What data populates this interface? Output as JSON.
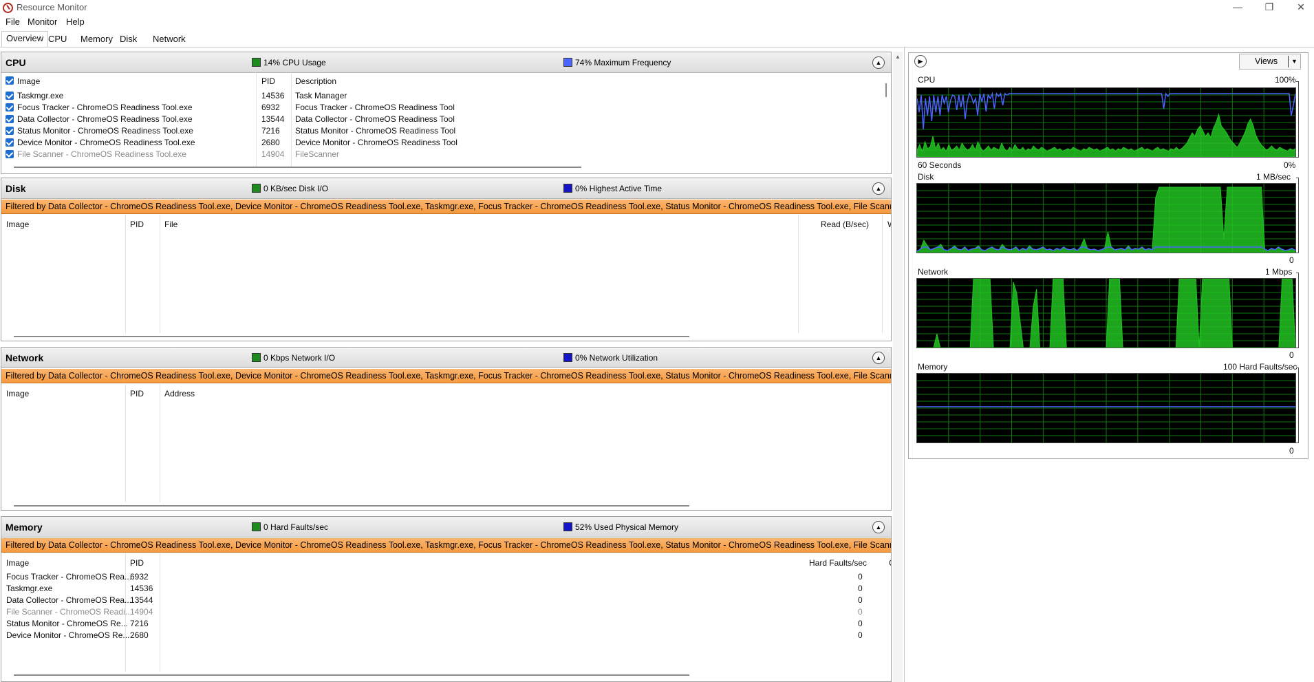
{
  "window": {
    "title": "Resource Monitor",
    "controls": {
      "minimize": "—",
      "restore": "❐",
      "close": "✕"
    }
  },
  "menu": [
    "File",
    "Monitor",
    "Help"
  ],
  "tabs": [
    "Overview",
    "CPU",
    "Memory",
    "Disk",
    "Network"
  ],
  "active_tab": "Overview",
  "colors": {
    "filter_bar": "#f59a3f",
    "legend_green": "#1f8a1f",
    "legend_blue": "#1515c8",
    "graph_bg": "#000000",
    "graph_grid": "#117711",
    "graph_fill": "#22c322",
    "graph_blue": "#4a64ff",
    "graph_orange": "#f08c1a"
  },
  "icons": {
    "collapse": "chevron-up-icon",
    "nav": "chevron-right-icon",
    "views_dropdown": "triangle-down-icon",
    "app": "resource-monitor-icon"
  },
  "cpu": {
    "title": "CPU",
    "usage": "14% CPU Usage",
    "frequency": "74% Maximum Frequency",
    "columns": [
      "Image",
      "PID",
      "Description"
    ],
    "rows": [
      {
        "image": "Taskmgr.exe",
        "pid": "14536",
        "description": "Task Manager"
      },
      {
        "image": "Focus Tracker - ChromeOS Readiness Tool.exe",
        "pid": "6932",
        "description": "Focus Tracker - ChromeOS Readiness Tool"
      },
      {
        "image": "Data Collector - ChromeOS Readiness Tool.exe",
        "pid": "13544",
        "description": "Data Collector - ChromeOS Readiness Tool"
      },
      {
        "image": "Status Monitor - ChromeOS Readiness Tool.exe",
        "pid": "7216",
        "description": "Status Monitor - ChromeOS Readiness Tool"
      },
      {
        "image": "Device Monitor - ChromeOS Readiness Tool.exe",
        "pid": "2680",
        "description": "Device Monitor - ChromeOS Readiness Tool"
      },
      {
        "image": "File Scanner - ChromeOS Readiness Tool.exe",
        "pid": "14904",
        "description": "FileScanner"
      }
    ]
  },
  "filter_text": "Filtered by Data Collector - ChromeOS Readiness Tool.exe, Device Monitor - ChromeOS Readiness Tool.exe, Taskmgr.exe, Focus Tracker - ChromeOS Readiness Tool.exe, Status Monitor - ChromeOS Readiness Tool.exe, File Scanner - ChromeOS",
  "disk": {
    "title": "Disk",
    "io": "0 KB/sec Disk I/O",
    "active": "0% Highest Active Time",
    "columns": [
      "Image",
      "PID",
      "File",
      "Read (B/sec)",
      "W"
    ]
  },
  "network": {
    "title": "Network",
    "io": "0 Kbps Network I/O",
    "utilization": "0% Network Utilization",
    "columns": [
      "Image",
      "PID",
      "Address"
    ]
  },
  "memory": {
    "title": "Memory",
    "faults": "0 Hard Faults/sec",
    "used": "52% Used Physical Memory",
    "columns": [
      "Image",
      "PID",
      "Hard Faults/sec",
      "C"
    ],
    "rows": [
      {
        "image": "Focus Tracker - ChromeOS Rea...",
        "pid": "6932",
        "faults": "0"
      },
      {
        "image": "Taskmgr.exe",
        "pid": "14536",
        "faults": "0"
      },
      {
        "image": "Data Collector - ChromeOS Rea...",
        "pid": "13544",
        "faults": "0"
      },
      {
        "image": "File Scanner - ChromeOS Readi...",
        "pid": "14904",
        "faults": "0"
      },
      {
        "image": "Status Monitor - ChromeOS Re...",
        "pid": "7216",
        "faults": "0"
      },
      {
        "image": "Device Monitor - ChromeOS Re...",
        "pid": "2680",
        "faults": "0"
      }
    ]
  },
  "graphs": {
    "views_label": "Views",
    "cpu": {
      "label": "CPU",
      "max": "100%",
      "time": "60 Seconds",
      "min": "0%"
    },
    "disk": {
      "label": "Disk",
      "max": "1 MB/sec",
      "min": "0"
    },
    "network": {
      "label": "Network",
      "max": "1 Mbps",
      "min": "0"
    },
    "memory": {
      "label": "Memory",
      "max": "100 Hard Faults/sec",
      "min": "0"
    }
  },
  "graph_series": {
    "cpu_blue": [
      85,
      65,
      90,
      40,
      85,
      60,
      88,
      52,
      90,
      65,
      88,
      60,
      90,
      78,
      88,
      65,
      82,
      90,
      88,
      68,
      90,
      72,
      90,
      55,
      80,
      92,
      88,
      78,
      85,
      60,
      92,
      80,
      92,
      66,
      90,
      85,
      92,
      70,
      92,
      88,
      92,
      75,
      92,
      90,
      92,
      92,
      92,
      92,
      92,
      92,
      92,
      92,
      92,
      92,
      92,
      92,
      92,
      92,
      92,
      92,
      92,
      92,
      92,
      92,
      92,
      92,
      92,
      92,
      92,
      92,
      92,
      92,
      92,
      92,
      92,
      92,
      92,
      92,
      92,
      92,
      92,
      92,
      92,
      92,
      92,
      92,
      92,
      92,
      92,
      92,
      92,
      92,
      92,
      92,
      92,
      92,
      92,
      92,
      92,
      92,
      92,
      92,
      92,
      92,
      92,
      92,
      92,
      92,
      92,
      92,
      92,
      92,
      92,
      92,
      92,
      92,
      92,
      92,
      70,
      92,
      88,
      92,
      92,
      92,
      92,
      92,
      92,
      92,
      92,
      92,
      92,
      92,
      92,
      92,
      92,
      92,
      92,
      92,
      92,
      92,
      92,
      92,
      92,
      92,
      92,
      92,
      92,
      92,
      92,
      92,
      92,
      92,
      92,
      92,
      92,
      92,
      92,
      92,
      92,
      92,
      92,
      92,
      92,
      92,
      92,
      92,
      92,
      92,
      92,
      92,
      92,
      92,
      92,
      92,
      92,
      92,
      92,
      92,
      92,
      60,
      75,
      92
    ],
    "cpu_green": [
      10,
      18,
      8,
      22,
      12,
      15,
      30,
      12,
      20,
      10,
      14,
      8,
      18,
      10,
      12,
      16,
      10,
      20,
      14,
      10,
      12,
      18,
      10,
      22,
      14,
      8,
      12,
      16,
      10,
      14,
      12,
      10,
      20,
      12,
      8,
      14,
      10,
      18,
      12,
      10,
      14,
      8,
      12,
      10,
      16,
      12,
      10,
      14,
      12,
      8,
      10,
      12,
      14,
      10,
      12,
      8,
      10,
      12,
      10,
      14,
      12,
      10,
      8,
      12,
      10,
      14,
      12,
      10,
      12,
      8,
      10,
      12,
      14,
      10,
      12,
      8,
      12,
      10,
      14,
      12,
      10,
      12,
      8,
      10,
      12,
      14,
      10,
      12,
      10,
      8,
      12,
      14,
      10,
      12,
      10,
      8,
      12,
      10,
      14,
      10,
      12,
      16,
      20,
      28,
      35,
      30,
      40,
      45,
      38,
      30,
      35,
      28,
      42,
      50,
      62,
      45,
      40,
      35,
      28,
      22,
      18,
      14,
      20,
      28,
      36,
      48,
      55,
      46,
      32,
      24,
      18,
      14,
      10,
      12,
      16,
      12,
      10,
      14,
      12,
      10,
      8,
      12,
      10,
      12
    ],
    "disk_green": [
      2,
      5,
      18,
      10,
      4,
      6,
      8,
      12,
      4,
      3,
      6,
      10,
      5,
      4,
      8,
      3,
      5,
      6,
      10,
      4,
      3,
      6,
      8,
      5,
      4,
      12,
      6,
      4,
      5,
      8,
      3,
      6,
      4,
      10,
      5,
      4,
      6,
      8,
      4,
      5,
      3,
      6,
      4,
      8,
      5,
      4,
      6,
      3,
      8,
      20,
      6,
      4,
      5,
      3,
      4,
      6,
      30,
      8,
      4,
      5,
      6,
      4,
      10,
      4,
      6,
      5,
      8,
      4,
      6,
      4,
      80,
      95,
      95,
      95,
      95,
      95,
      95,
      95,
      95,
      95,
      95,
      95,
      95,
      95,
      95,
      95,
      95,
      95,
      95,
      95,
      20,
      95,
      95,
      95,
      95,
      95,
      95,
      95,
      95,
      95,
      95,
      95,
      5,
      3,
      6,
      4,
      8,
      5,
      3,
      4,
      6,
      3
    ],
    "network_green": [
      0,
      0,
      0,
      0,
      0,
      0,
      20,
      0,
      0,
      0,
      0,
      0,
      0,
      0,
      0,
      0,
      0,
      100,
      100,
      100,
      100,
      100,
      100,
      0,
      0,
      0,
      0,
      0,
      0,
      95,
      80,
      40,
      0,
      0,
      0,
      60,
      85,
      0,
      0,
      0,
      0,
      100,
      100,
      100,
      100,
      0,
      0,
      0,
      0,
      0,
      0,
      0,
      0,
      0,
      0,
      0,
      0,
      0,
      100,
      100,
      100,
      100,
      0,
      0,
      0,
      0,
      0,
      0,
      0,
      0,
      0,
      0,
      0,
      0,
      0,
      0,
      0,
      0,
      0,
      100,
      100,
      100,
      100,
      100,
      100,
      0,
      100,
      100,
      100,
      100,
      100,
      100,
      100,
      100,
      100,
      0,
      0,
      0,
      0,
      0,
      0,
      0,
      0,
      0,
      0,
      0,
      0,
      0,
      0,
      0,
      100,
      100,
      100,
      100,
      0
    ]
  }
}
